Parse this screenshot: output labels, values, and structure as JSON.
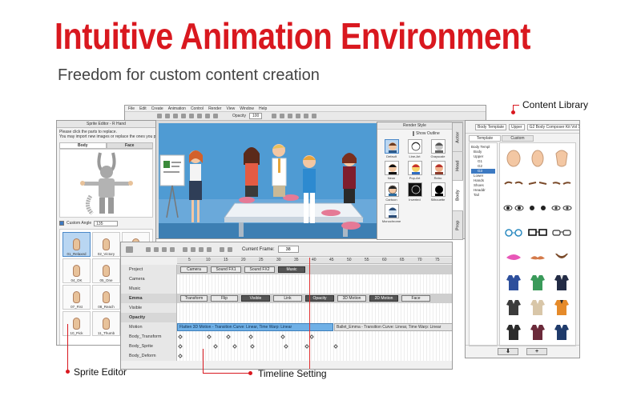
{
  "hero": {
    "headline": "Intuitive Animation Environment",
    "subheadline": "Freedom for custom content creation"
  },
  "callouts": {
    "content_library": "Content Library",
    "sprite_editor": "Sprite Editor",
    "timeline_setting": "Timeline Setting"
  },
  "sprite_editor": {
    "title": "Sprite Editor - R Hand",
    "help_line1": "Please click the parts to replace.",
    "help_line2": "You may import new images or replace the ones you picked.",
    "tabs": [
      "Body",
      "Face"
    ],
    "custom_angle_label": "Custom Angle",
    "angle_value": "135",
    "thumbs": [
      "01_Relaxed",
      "02_Victory",
      "03_Seven",
      "04_OK",
      "05_One",
      "06_Grab",
      "07_Fist",
      "08_Reach",
      "09_Thumb_b",
      "10_Pick",
      "11_Thumb",
      ""
    ]
  },
  "main_window": {
    "menu": [
      "File",
      "Edit",
      "Create",
      "Animation",
      "Control",
      "Render",
      "View",
      "Window",
      "Help"
    ],
    "opacity_label": "Opacity",
    "opacity_value": "100"
  },
  "render_style": {
    "title": "Render Style",
    "show_outline": "Show Outline",
    "styles": [
      "Default",
      "Line-Art",
      "Grayscale",
      "Neon",
      "Pop-Art",
      "Retro",
      "Cartoon",
      "Inverted",
      "Silhouette",
      "Monochrome"
    ]
  },
  "side_tabs": [
    "Actor",
    "Head",
    "Body",
    "Prop"
  ],
  "library": {
    "dropdown1": "Body Template",
    "dropdown2": "Upper",
    "dropdown3": "G2 Body Composer Kit Vol 1",
    "tabs": [
      "Template",
      "Custom"
    ],
    "tree": [
      "Body Templ",
      "Body",
      "Upper",
      "G1",
      "G2",
      "G3",
      "Lower",
      "Hands",
      "Shoes",
      "Headdr",
      "Tail"
    ],
    "add_button": "+",
    "download_button": "⬇"
  },
  "timeline": {
    "current_frame_label": "Current Frame:",
    "current_frame_value": "38",
    "ruler_ticks": [
      "5",
      "10",
      "15",
      "20",
      "25",
      "30",
      "35",
      "40",
      "45",
      "50",
      "55",
      "60",
      "65",
      "70",
      "75",
      "80"
    ],
    "tracks": {
      "project": "Project",
      "camera": "Camera",
      "music": "Music",
      "emma": "Emma",
      "visible": "Visible",
      "opacity": "Opacity",
      "motion": "Motion",
      "body_transform": "Body_Transform",
      "body_sprite": "Body_Sprite",
      "body_deform": "Body_Deform"
    },
    "project_chips": [
      "Camera",
      "Sound FX1",
      "Sound FX2",
      "Music"
    ],
    "emma_chips": [
      "Transform",
      "Flip",
      "Visible",
      "Link",
      "Opacity",
      "3D Motion",
      "2D Motion",
      "Face"
    ],
    "motion_clip1": "Flatten 3D Motion - Transition Curve: Linear, Time Warp: Linear",
    "motion_clip2": "Ballet_Emma - Transition Curve: Linear, Time Warp: Linear"
  },
  "colors": {
    "brand_red": "#d9181f",
    "stage_blue": "#4f9bd3",
    "motion_blue": "#6fb0e6",
    "selected": "#b9d6f2"
  }
}
